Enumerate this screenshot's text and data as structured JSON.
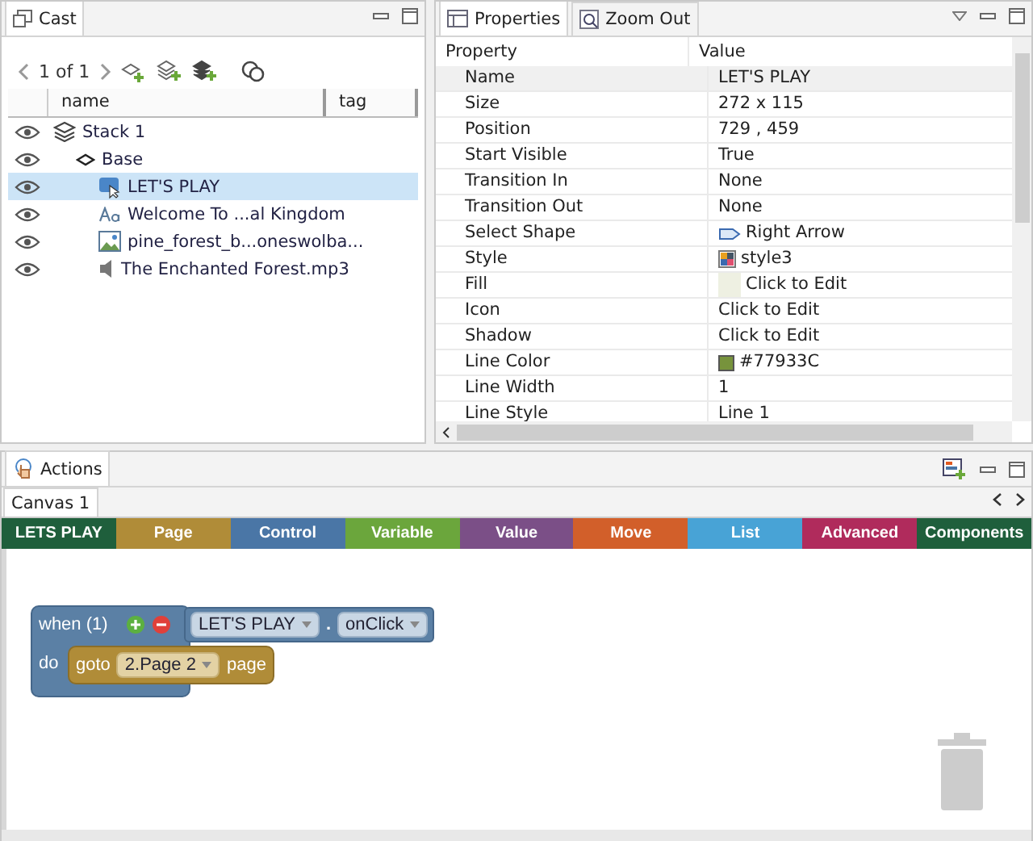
{
  "cast": {
    "tab": "Cast",
    "pager": "1 of 1",
    "columns": [
      "name",
      "tag"
    ],
    "tree": [
      {
        "kind": "stack",
        "label": "Stack 1",
        "selected": false,
        "children": [
          {
            "kind": "layer",
            "label": "Base",
            "selected": false,
            "children": [
              {
                "kind": "button",
                "label": "LET'S PLAY",
                "selected": true
              },
              {
                "kind": "text",
                "label": "Welcome To ...al Kingdom",
                "selected": false
              },
              {
                "kind": "image",
                "label": "pine_forest_b...oneswolba...",
                "selected": false
              },
              {
                "kind": "sound",
                "label": "The Enchanted Forest.mp3",
                "selected": false
              }
            ]
          }
        ]
      }
    ]
  },
  "properties": {
    "tabs": [
      {
        "label": "Properties",
        "selected": true
      },
      {
        "label": "Zoom Out",
        "selected": false
      }
    ],
    "columns": [
      "Property",
      "Value"
    ],
    "rows": [
      {
        "name": "Name",
        "value": "LET'S PLAY",
        "selected": true
      },
      {
        "name": "Size",
        "value": "272 x 115",
        "selected": false
      },
      {
        "name": "Position",
        "value": "729 , 459",
        "selected": false
      },
      {
        "name": "Start Visible",
        "value": "True",
        "selected": false
      },
      {
        "name": "Transition In",
        "value": "None",
        "selected": false
      },
      {
        "name": "Transition Out",
        "value": "None",
        "selected": false
      },
      {
        "name": "Select Shape",
        "value": "Right Arrow",
        "selected": false,
        "kind": "shape"
      },
      {
        "name": "Style",
        "value": "style3",
        "selected": false,
        "kind": "style"
      },
      {
        "name": "Fill",
        "value": "Click to Edit",
        "selected": false,
        "kind": "swatch",
        "color": "#eef0e2"
      },
      {
        "name": "Icon",
        "value": "Click to Edit",
        "selected": false
      },
      {
        "name": "Shadow",
        "value": "Click to Edit",
        "selected": false
      },
      {
        "name": "Line Color",
        "value": "#77933C",
        "selected": false,
        "kind": "swatch",
        "color": "#77933c"
      },
      {
        "name": "Line Width",
        "value": "1",
        "selected": false
      },
      {
        "name": "Line Style",
        "value": "Line 1",
        "selected": false
      }
    ]
  },
  "actions": {
    "tab": "Actions",
    "canvas_tab": "Canvas 1",
    "categories": [
      {
        "label": "LETS PLAY",
        "color": "#1f5f3c"
      },
      {
        "label": "Page",
        "color": "#b08c38"
      },
      {
        "label": "Control",
        "color": "#4a76a6"
      },
      {
        "label": "Variable",
        "color": "#6ba63c"
      },
      {
        "label": "Value",
        "color": "#7b4f87"
      },
      {
        "label": "Move",
        "color": "#d25f2a"
      },
      {
        "label": "List",
        "color": "#48a3d6"
      },
      {
        "label": "Advanced",
        "color": "#b02b5c"
      },
      {
        "label": "Components",
        "color": "#1f5f3c"
      }
    ],
    "event_block": {
      "when": "when (1)",
      "object": "LET'S PLAY",
      "dot": ".",
      "event": "onClick",
      "do": "do"
    },
    "goto_block": {
      "verb": "goto",
      "target": "2.Page 2",
      "suffix": "page"
    }
  }
}
